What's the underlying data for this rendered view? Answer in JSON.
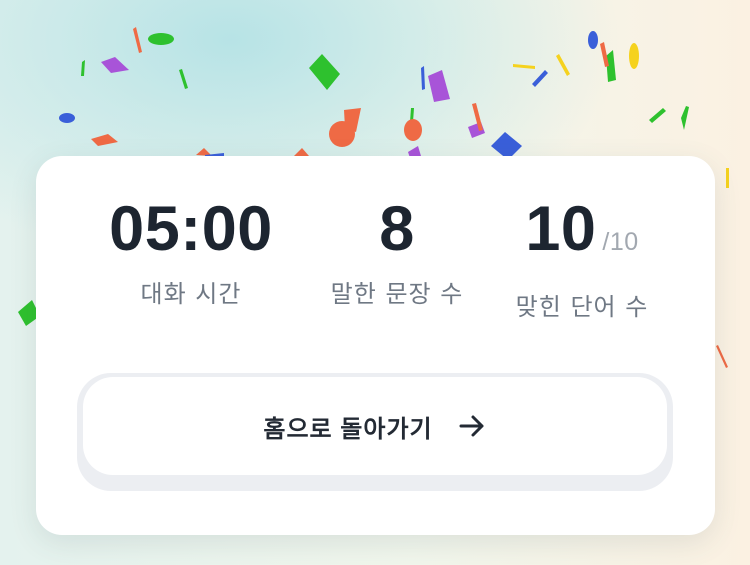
{
  "stats": [
    {
      "value": "05:00",
      "suffix": "",
      "label": "대화 시간"
    },
    {
      "value": "8",
      "suffix": "",
      "label": "말한 문장 수"
    },
    {
      "value": "10",
      "suffix": "/10",
      "label": "맞힌 단어 수"
    }
  ],
  "home_button": {
    "label": "홈으로 돌아가기",
    "icon": "arrow-right-icon"
  },
  "colors": {
    "confetti": [
      "#2ec12e",
      "#a854d8",
      "#ef6a45",
      "#3a5fd9",
      "#f5d21e"
    ],
    "text_primary": "#1d2530",
    "text_secondary": "#6f7884"
  }
}
